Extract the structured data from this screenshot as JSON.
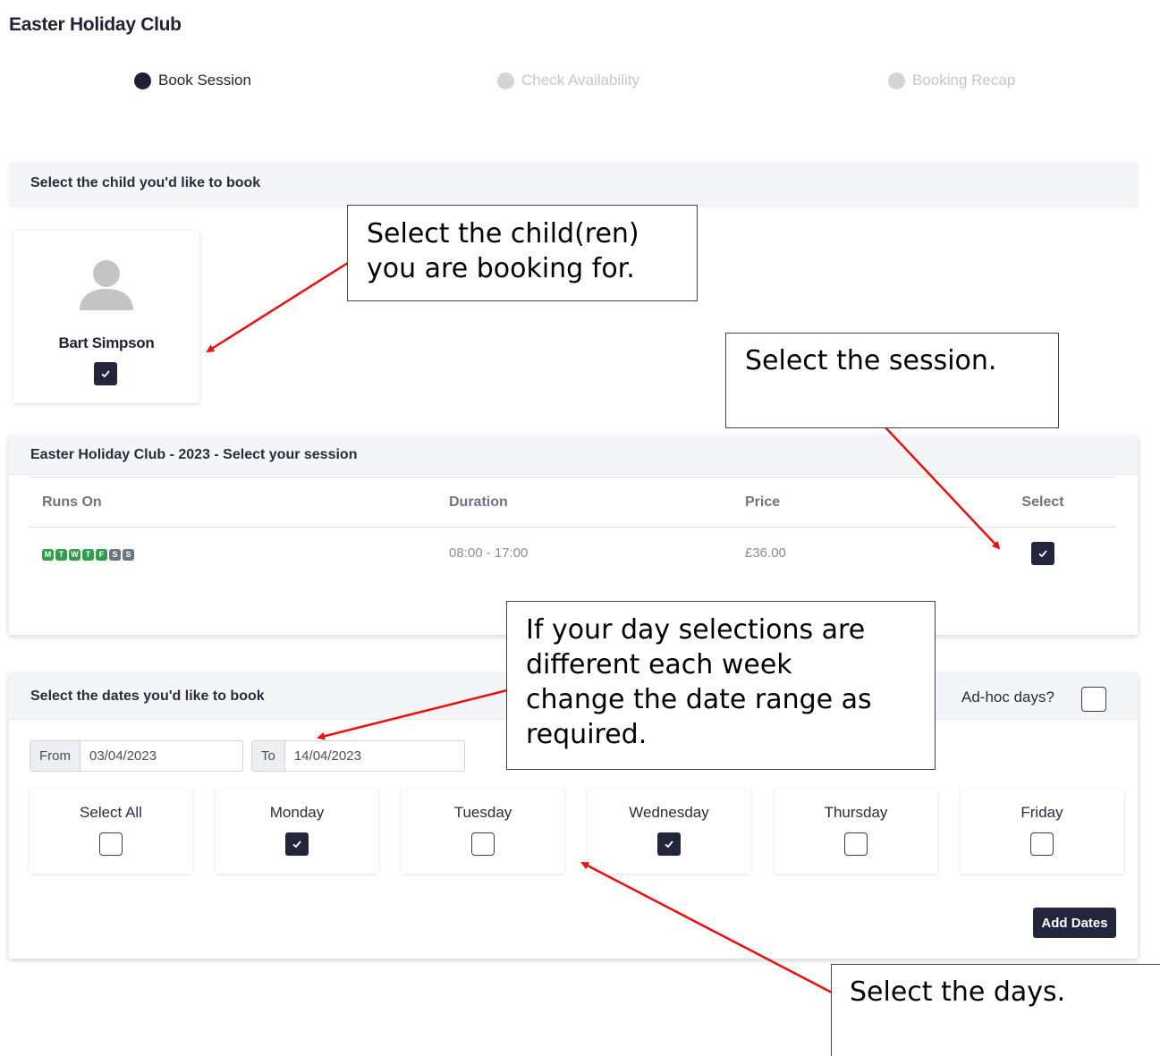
{
  "page": {
    "title": "Easter Holiday Club"
  },
  "stepper": {
    "steps": [
      {
        "label": "Book Session",
        "state": "active"
      },
      {
        "label": "Check Availability",
        "state": "inactive"
      },
      {
        "label": "Booking Recap",
        "state": "inactive"
      }
    ]
  },
  "child_section": {
    "header": "Select the child you'd like to book",
    "children": [
      {
        "name": "Bart Simpson",
        "selected": true,
        "icon": "user-avatar-icon"
      }
    ]
  },
  "session_section": {
    "header": "Easter Holiday Club - 2023 - Select your session",
    "columns": [
      "Runs On",
      "Duration",
      "Price",
      "Select"
    ],
    "rows": [
      {
        "days": [
          {
            "letter": "M",
            "active": true
          },
          {
            "letter": "T",
            "active": true
          },
          {
            "letter": "W",
            "active": true
          },
          {
            "letter": "T",
            "active": true
          },
          {
            "letter": "F",
            "active": true
          },
          {
            "letter": "S",
            "active": false
          },
          {
            "letter": "S",
            "active": false
          }
        ],
        "duration": "08:00 - 17:00",
        "price": "£36.00",
        "selected": true
      }
    ]
  },
  "dates_section": {
    "header": "Select the dates you'd like to book",
    "adhoc_label": "Ad-hoc days?",
    "adhoc_checked": false,
    "from_label": "From",
    "from_value": "03/04/2023",
    "to_label": "To",
    "to_value": "14/04/2023",
    "days": [
      {
        "label": "Select All",
        "checked": false
      },
      {
        "label": "Monday",
        "checked": true
      },
      {
        "label": "Tuesday",
        "checked": false
      },
      {
        "label": "Wednesday",
        "checked": true
      },
      {
        "label": "Thursday",
        "checked": false
      },
      {
        "label": "Friday",
        "checked": false
      }
    ],
    "add_button": "Add Dates"
  },
  "annotations": {
    "child": [
      "Select the child(ren)",
      "you are booking for."
    ],
    "session": [
      "Select the session."
    ],
    "dates": [
      "If your day selections are",
      "different each week",
      "change the date range as",
      "required."
    ],
    "days": [
      "Select the days."
    ]
  },
  "colors": {
    "primary": "#23253d",
    "day_active": "#2e9e4a",
    "day_inactive": "#6c757d",
    "arrow": "#e8110f"
  }
}
